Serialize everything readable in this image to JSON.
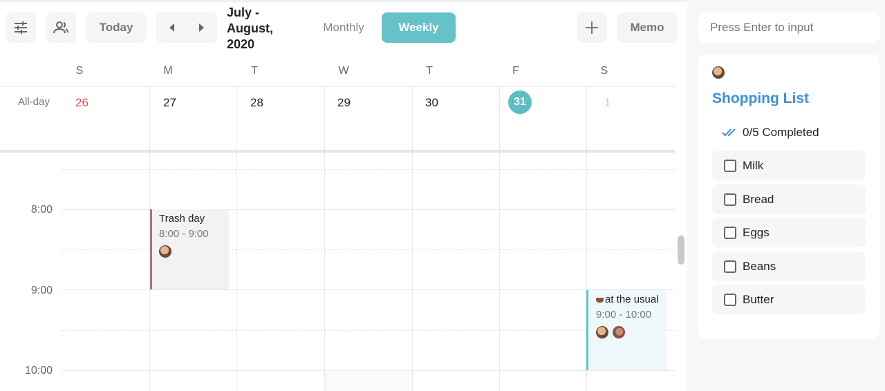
{
  "toolbar": {
    "settings_icon": "sliders-icon",
    "people_icon": "people-icon",
    "today_label": "Today",
    "prev_icon": "caret-left-icon",
    "next_icon": "caret-right-icon",
    "title": "July - August, 2020",
    "view_monthly": "Monthly",
    "view_weekly": "Weekly",
    "add_icon": "plus-icon",
    "memo_label": "Memo"
  },
  "calendar": {
    "day_headers": [
      "S",
      "M",
      "T",
      "W",
      "T",
      "F",
      "S"
    ],
    "allday_label": "All-day",
    "dates": [
      "26",
      "27",
      "28",
      "29",
      "30",
      "31",
      "1"
    ],
    "today_date": "31",
    "times": [
      "8:00",
      "9:00",
      "10:00"
    ],
    "events": [
      {
        "title": "Trash day",
        "time": "8:00 - 9:00",
        "color": "#9c7b76"
      },
      {
        "title": "at the usual",
        "prefix_icon": "coffee-icon",
        "time": "9:00 - 10:00",
        "color": "#66c2c8"
      }
    ]
  },
  "memo": {
    "input_placeholder": "Press Enter to input",
    "card_title": "Shopping List",
    "progress_text": "0/5 Completed",
    "items": [
      "Milk",
      "Bread",
      "Eggs",
      "Beans",
      "Butter"
    ]
  },
  "colors": {
    "accent": "#66c2c8",
    "link_blue": "#3d8fdc",
    "sunday_red": "#e14b4b"
  }
}
